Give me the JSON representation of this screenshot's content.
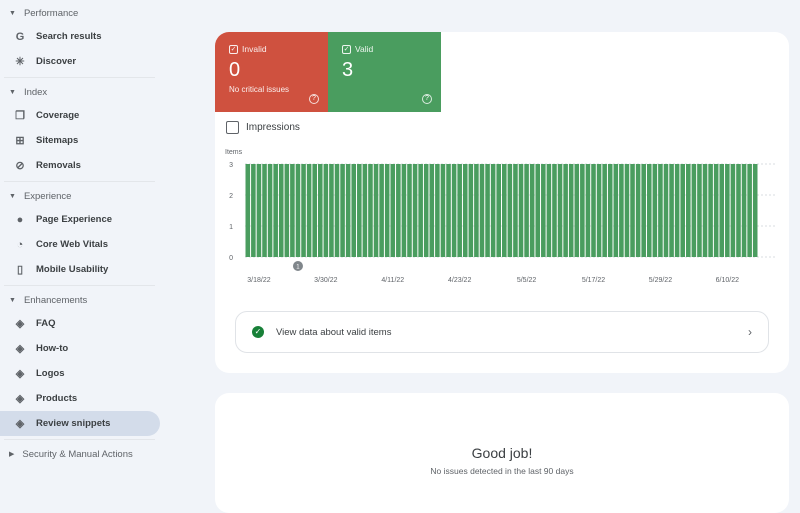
{
  "sidebar": {
    "sections": [
      {
        "label": "Performance",
        "items": [
          {
            "label": "Search results",
            "icon": "google-g-icon"
          },
          {
            "label": "Discover",
            "icon": "asterisk-icon"
          }
        ]
      },
      {
        "label": "Index",
        "items": [
          {
            "label": "Coverage",
            "icon": "pages-icon"
          },
          {
            "label": "Sitemaps",
            "icon": "sitemap-icon"
          },
          {
            "label": "Removals",
            "icon": "eye-off-icon"
          }
        ]
      },
      {
        "label": "Experience",
        "items": [
          {
            "label": "Page Experience",
            "icon": "circle-plus-icon"
          },
          {
            "label": "Core Web Vitals",
            "icon": "gauge-icon"
          },
          {
            "label": "Mobile Usability",
            "icon": "phone-icon"
          }
        ]
      },
      {
        "label": "Enhancements",
        "items": [
          {
            "label": "FAQ",
            "icon": "layers-icon"
          },
          {
            "label": "How-to",
            "icon": "layers-icon"
          },
          {
            "label": "Logos",
            "icon": "layers-icon"
          },
          {
            "label": "Products",
            "icon": "layers-icon"
          },
          {
            "label": "Review snippets",
            "icon": "layers-icon",
            "active": true
          }
        ]
      }
    ],
    "collapsed_section": "Security & Manual Actions"
  },
  "tiles": {
    "invalid": {
      "label": "Invalid",
      "value": "0",
      "sub": "No critical issues",
      "color": "#cf513f"
    },
    "valid": {
      "label": "Valid",
      "value": "3",
      "color": "#4a9d5f"
    }
  },
  "impressions_label": "Impressions",
  "annotation_marker": "1",
  "view_valid_label": "View data about valid items",
  "good_job": {
    "title": "Good job!",
    "sub": "No issues detected in the last 90 days"
  },
  "chart_data": {
    "type": "bar",
    "ylabel": "Items",
    "ylim": [
      0,
      3
    ],
    "yticks": [
      "0",
      "1",
      "2",
      "3"
    ],
    "start_date": "3/16/22",
    "xtick_labels": [
      "3/18/22",
      "3/30/22",
      "4/11/22",
      "4/23/22",
      "5/5/22",
      "5/17/22",
      "5/29/22",
      "6/10/22"
    ],
    "xtick_day_index": [
      2,
      14,
      26,
      38,
      50,
      62,
      74,
      86
    ],
    "values": [
      3,
      3,
      3,
      3,
      3,
      3,
      3,
      3,
      3,
      3,
      3,
      3,
      3,
      3,
      3,
      3,
      3,
      3,
      3,
      3,
      3,
      3,
      3,
      3,
      3,
      3,
      3,
      3,
      3,
      3,
      3,
      3,
      3,
      3,
      3,
      3,
      3,
      3,
      3,
      3,
      3,
      3,
      3,
      3,
      3,
      3,
      3,
      3,
      3,
      3,
      3,
      3,
      3,
      3,
      3,
      3,
      3,
      3,
      3,
      3,
      3,
      3,
      3,
      3,
      3,
      3,
      3,
      3,
      3,
      3,
      3,
      3,
      3,
      3,
      3,
      3,
      3,
      3,
      3,
      3,
      3,
      3,
      3,
      3,
      3,
      3,
      3,
      3,
      3,
      3,
      3,
      3
    ],
    "color": "#4a9d5f"
  }
}
